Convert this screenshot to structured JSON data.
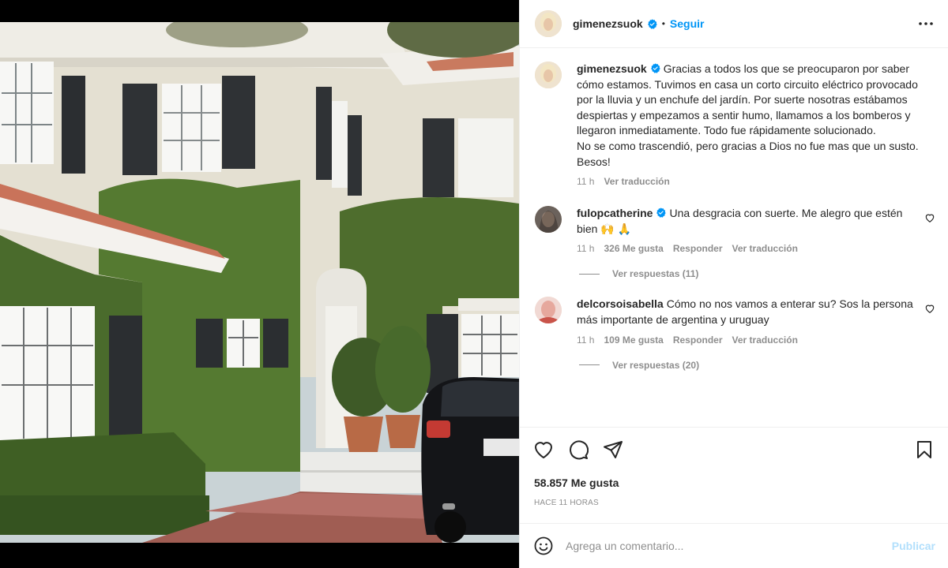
{
  "post": {
    "username": "gimenezsuok",
    "separator": "•",
    "follow_label": "Seguir",
    "more_icon": "more-horizontal-icon"
  },
  "comments": [
    {
      "username": "gimenezsuok",
      "text": "Gracias a todos los que se preocuparon por saber cómo estamos. Tuvimos en casa un corto circuito eléctrico provocado por la lluvia y un enchufe del jardín. Por suerte nosotras estábamos despiertas y empezamos a sentir humo, llamamos a los bomberos y llegaron inmediatamente. Todo fue rápidamente solucionado.",
      "text2": "No se como trascendió, pero gracias a Dios no fue mas que un susto. Besos!",
      "time": "11 h",
      "translate": "Ver traducción"
    },
    {
      "username": "fulopcatherine",
      "text": "Una desgracia con suerte. Me alegro que estén bien 🙌 🙏",
      "time": "11 h",
      "likes": "326 Me gusta",
      "reply": "Responder",
      "translate": "Ver traducción",
      "replies": "Ver respuestas (11)"
    },
    {
      "username": "delcorsoisabella",
      "text": "Cómo no nos vamos a enterar su? Sos la persona más importante de argentina y uruguay",
      "time": "11 h",
      "likes": "109 Me gusta",
      "reply": "Responder",
      "translate": "Ver traducción",
      "replies": "Ver respuestas (20)"
    }
  ],
  "actions": {
    "like_icon": "heart-icon",
    "comment_icon": "comment-icon",
    "share_icon": "paper-plane-icon",
    "save_icon": "bookmark-icon",
    "likes_count": "58.857 Me gusta",
    "timestamp": "HACE 11 HORAS"
  },
  "composer": {
    "emoji_icon": "smiley-icon",
    "placeholder": "Agrega un comentario...",
    "publish_label": "Publicar"
  },
  "colors": {
    "accent": "#0095f6",
    "publish_disabled": "#b2dffc",
    "muted": "#8e8e8e",
    "text": "#262626"
  }
}
